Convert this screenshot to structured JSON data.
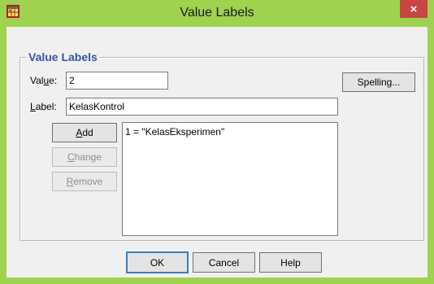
{
  "window": {
    "title": "Value Labels",
    "close_glyph": "×",
    "icon": "spss-grid-icon",
    "colors": {
      "titlebar": "#9fd24f",
      "close": "#c7473f",
      "legend": "#3a51a3"
    }
  },
  "group": {
    "legend": "Value Labels"
  },
  "value_field": {
    "label_prefix": "Val",
    "label_mnemonic": "u",
    "label_suffix": "e:",
    "value": "2"
  },
  "label_field": {
    "label_mnemonic": "L",
    "label_suffix": "abel:",
    "value": "KelasKontrol"
  },
  "buttons": {
    "spelling": "Spelling...",
    "add_mnemonic": "A",
    "add_rest": "dd",
    "change_mnemonic": "C",
    "change_rest": "hange",
    "remove_mnemonic": "R",
    "remove_rest": "emove",
    "ok": "OK",
    "cancel": "Cancel",
    "help": "Help"
  },
  "list": {
    "items": [
      "1 = \"KelasEksperimen\""
    ]
  }
}
